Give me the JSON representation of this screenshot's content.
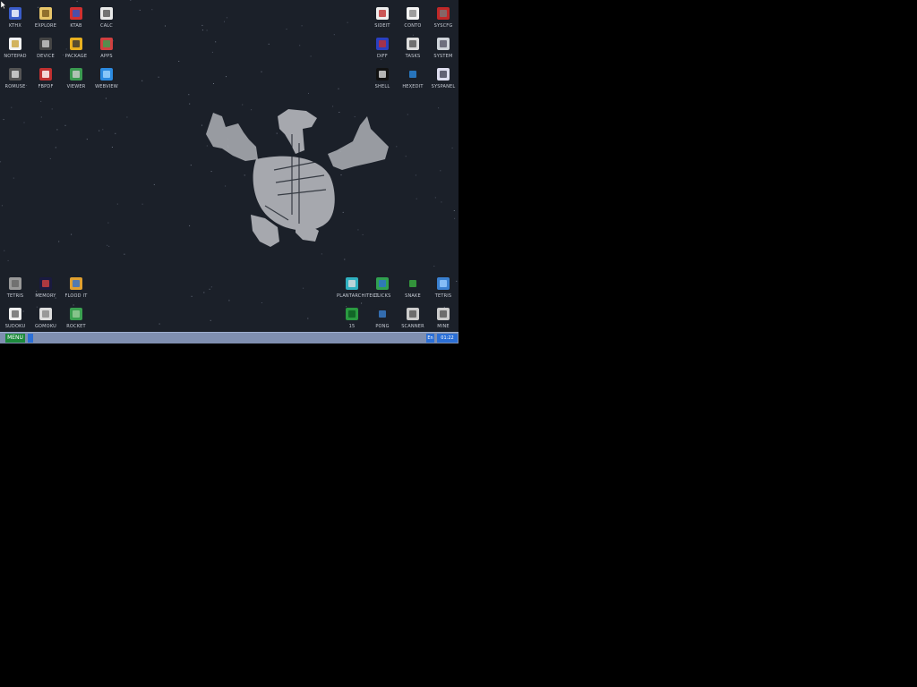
{
  "desktop": {
    "icons_left_top": [
      {
        "label": "KTHX",
        "icon": "document-icon"
      },
      {
        "label": "EXPLORE",
        "icon": "folder-icon"
      },
      {
        "label": "KTAB",
        "icon": "picture-icon"
      },
      {
        "label": "CALC",
        "icon": "calculator-icon"
      },
      {
        "label": "NOTEPAD",
        "icon": "notepad-icon"
      },
      {
        "label": "DEVICE",
        "icon": "device-icon"
      },
      {
        "label": "PACKAGE",
        "icon": "tools-icon"
      },
      {
        "label": "APPS",
        "icon": "cube-icon"
      },
      {
        "label": "ROMUSE",
        "icon": "disk-icon"
      },
      {
        "label": "FBPDF",
        "icon": "pdf-icon"
      },
      {
        "label": "VIEWER",
        "icon": "image-icon"
      },
      {
        "label": "WEBVIEW",
        "icon": "globe-icon"
      }
    ],
    "icons_right_top": [
      {
        "label": "SIDEIT",
        "icon": "chart-icon"
      },
      {
        "label": "CONTO",
        "icon": "window-icon"
      },
      {
        "label": "SYSCFG",
        "icon": "wrench-icon"
      },
      {
        "label": "DIFF",
        "icon": "compare-icon"
      },
      {
        "label": "TASKS",
        "icon": "chip-icon"
      },
      {
        "label": "SYSTEM",
        "icon": "settings-icon"
      },
      {
        "label": "SHELL",
        "icon": "terminal-icon"
      },
      {
        "label": "HEXEDIT",
        "icon": "hex-editor-icon"
      },
      {
        "label": "SYSPANEL",
        "icon": "sliders-icon"
      }
    ],
    "icons_left_bottom": [
      {
        "label": "TETRIS",
        "icon": "game-icon"
      },
      {
        "label": "MEMORY",
        "icon": "blocks-icon"
      },
      {
        "label": "FLOOD IT",
        "icon": "flood-icon"
      },
      {
        "label": "SUDOKU",
        "icon": "sudoku-icon"
      },
      {
        "label": "GOMOKU",
        "icon": "checker-icon"
      },
      {
        "label": "ROCKET",
        "icon": "rocket-icon"
      }
    ],
    "icons_right_bottom": [
      {
        "label": "PLANTARCHITECT",
        "icon": "plant-icon"
      },
      {
        "label": "CLICKS",
        "icon": "bars-icon"
      },
      {
        "label": "SNAKE",
        "icon": "snake-icon"
      },
      {
        "label": "TETRIS",
        "icon": "tetris-icon"
      },
      {
        "label": "15",
        "icon": "grid-icon"
      },
      {
        "label": "PONG",
        "icon": "pong-icon"
      },
      {
        "label": "SCANNER",
        "icon": "scanner-icon"
      },
      {
        "label": "MINE",
        "icon": "mine-icon"
      }
    ]
  },
  "taskbar": {
    "menu_label": "MENU",
    "lang": "En",
    "clock": "01:22"
  },
  "colors": {
    "desktop_bg": "#1b2029",
    "taskbar_bg": "#7f8fb0",
    "menu_bg": "#1d8a3c",
    "tray_bg": "#2b6fd6",
    "mascot": "#a6a8ae"
  }
}
